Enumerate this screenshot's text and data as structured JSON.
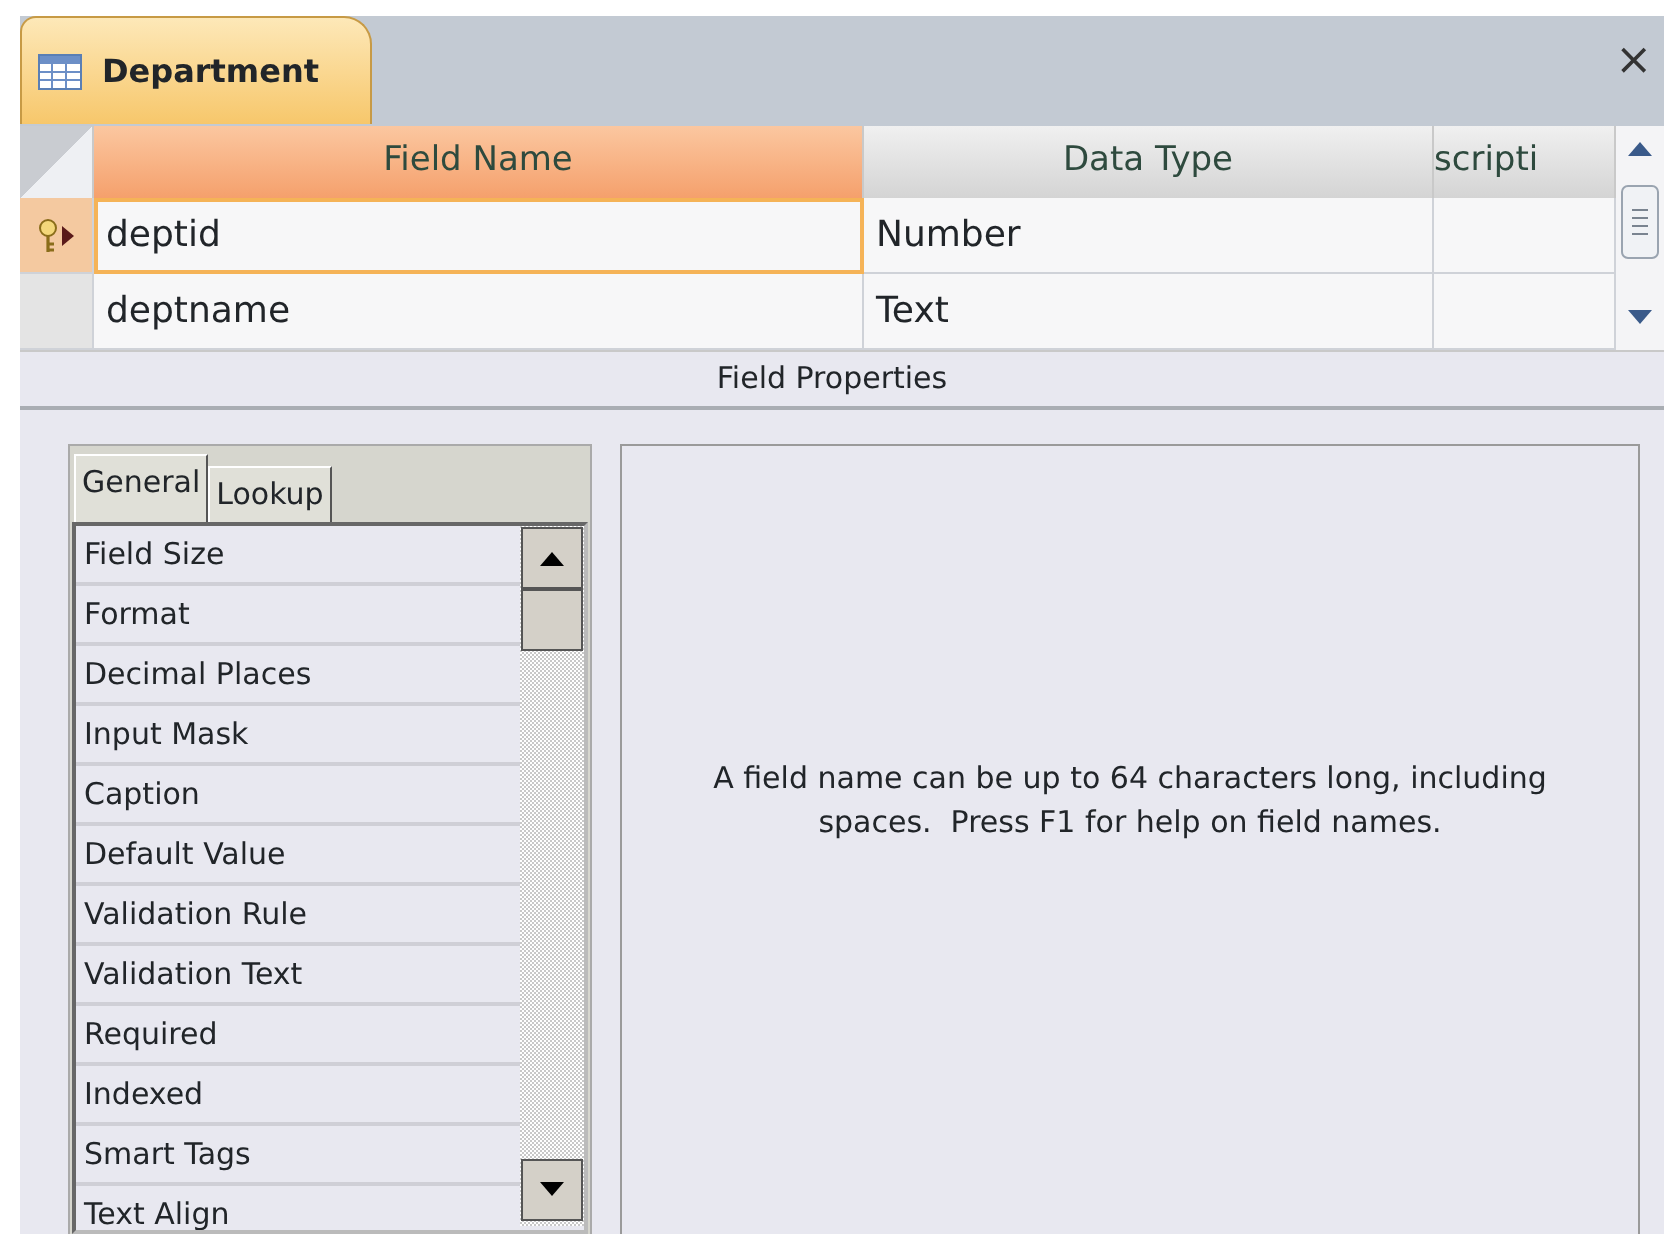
{
  "document_tab": {
    "title": "Department",
    "selected": true
  },
  "close_button": "×",
  "grid": {
    "columns": [
      {
        "label": "Field Name",
        "selected": true
      },
      {
        "label": "Data Type",
        "selected": false
      },
      {
        "label": "scripti",
        "selected": false
      }
    ],
    "rows": [
      {
        "field_name": "deptid",
        "data_type": "Number",
        "primary_key": true,
        "selected": true
      },
      {
        "field_name": "deptname",
        "data_type": "Text",
        "primary_key": false,
        "selected": false
      }
    ]
  },
  "field_properties": {
    "title": "Field Properties",
    "tabs": [
      {
        "label": "General",
        "selected": true
      },
      {
        "label": "Lookup",
        "selected": false
      }
    ],
    "properties": [
      "Field Size",
      "Format",
      "Decimal Places",
      "Input Mask",
      "Caption",
      "Default Value",
      "Validation Rule",
      "Validation Text",
      "Required",
      "Indexed",
      "Smart Tags",
      "Text Align"
    ],
    "help_text": "A field name can be up to 64 characters long, including spaces.  Press F1 for help on field names."
  }
}
